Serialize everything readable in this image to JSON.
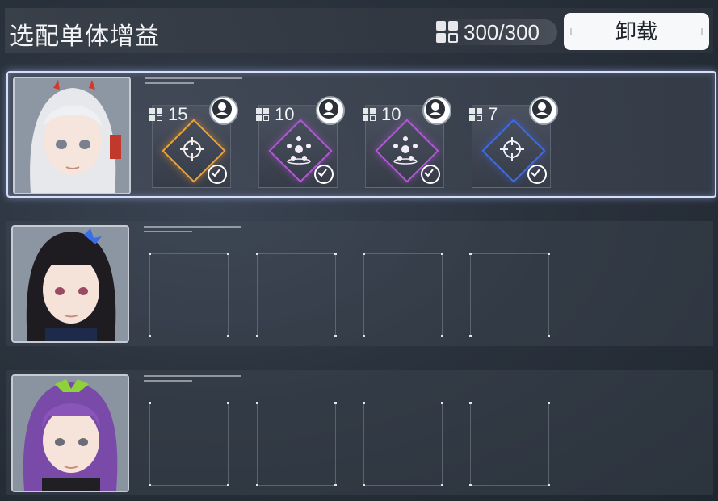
{
  "header": {
    "title": "选配单体增益",
    "capacity": "300/300",
    "unload_label": "卸载"
  },
  "rows": [
    {
      "selected": true,
      "slots": [
        {
          "cost": "15",
          "type": "crosshair",
          "color": "#f1a230"
        },
        {
          "cost": "10",
          "type": "burst",
          "color": "#b356d8"
        },
        {
          "cost": "10",
          "type": "burst",
          "color": "#b356d8"
        },
        {
          "cost": "7",
          "type": "crosshair",
          "color": "#3f69e8"
        }
      ]
    },
    {
      "selected": false,
      "slots": []
    },
    {
      "selected": false,
      "slots": []
    }
  ],
  "colors": {
    "accent_border": "#d7def7",
    "button_bg": "#f7f8f9"
  }
}
